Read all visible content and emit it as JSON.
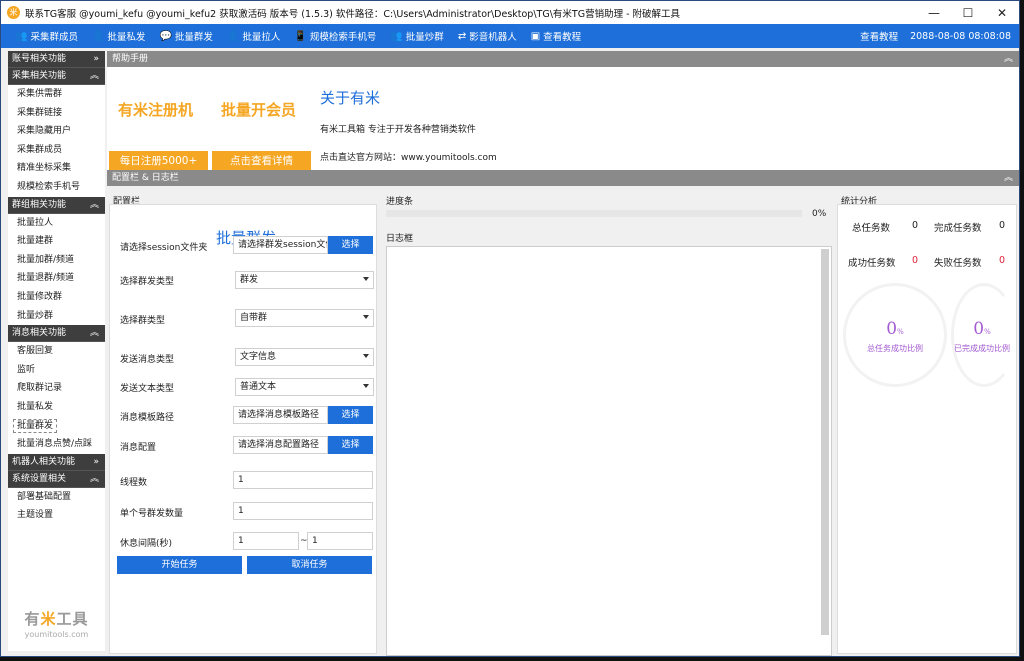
{
  "window": {
    "app_icon": "米",
    "title": "联系TG客服 @youmi_kefu @youmi_kefu2 获取激活码 版本号 (1.5.3) 软件路径：C:\\Users\\Administrator\\Desktop\\TG\\有米TG营销助理 - 附破解工具",
    "min_icon": "—",
    "max_icon": "☐",
    "close_icon": "✕"
  },
  "menubar": {
    "items": [
      {
        "icon": "👥",
        "label": "采集群成员"
      },
      {
        "icon": "👤",
        "label": "批量私发"
      },
      {
        "icon": "💬",
        "label": "批量群发"
      },
      {
        "icon": "👤",
        "label": "批量拉人"
      },
      {
        "icon": "📱",
        "label": "规模检索手机号"
      },
      {
        "icon": "👥",
        "label": "批量炒群"
      },
      {
        "icon": "⇄",
        "label": "影音机器人"
      },
      {
        "icon": "▣",
        "label": "查看教程"
      }
    ],
    "right_link": "查看教程",
    "datetime": "2088-08-08 08:08:08"
  },
  "sidebar": {
    "sections": [
      {
        "title": "账号相关功能",
        "chevron": "»",
        "items": []
      },
      {
        "title": "采集相关功能",
        "chevron": "︽",
        "items": [
          "采集供需群",
          "采集群链接",
          "采集隐藏用户",
          "采集群成员",
          "精准坐标采集",
          "规模检索手机号"
        ]
      },
      {
        "title": "群组相关功能",
        "chevron": "︽",
        "items": [
          "批量拉人",
          "批量建群",
          "批量加群/频道",
          "批量退群/频道",
          "批量修改群",
          "批量炒群"
        ]
      },
      {
        "title": "消息相关功能",
        "chevron": "︽",
        "items": [
          "客服回复",
          "监听",
          "爬取群记录",
          "批量私发",
          "批量群发",
          "批量消息点赞/点踩"
        ]
      },
      {
        "title": "机器人相关功能",
        "chevron": "»",
        "items": []
      },
      {
        "title": "系统设置相关",
        "chevron": "︽",
        "items": [
          "部署基础配置",
          "主题设置"
        ]
      }
    ],
    "active_item": "批量群发",
    "logo_a": "有",
    "logo_b": "米",
    "logo_c": "工具",
    "logo_url": "youmitools.com"
  },
  "help": {
    "header": "帮助手册",
    "chevron": "︽",
    "promo_left": "有米注册机",
    "promo_right": "批量开会员",
    "btn_left": "每日注册5000+",
    "btn_right": "点击查看详情",
    "about_title": "关于有米",
    "about_desc": "有米工具箱 专注于开发各种营销类软件",
    "about_site": "点击直达官方网站：www.youmitools.com"
  },
  "config_bar": {
    "header": "配置栏 & 日志栏",
    "chevron": "︽"
  },
  "config": {
    "group_title": "配置栏",
    "title": "批量群发",
    "session_label": "请选择session文件夹",
    "session_value": "请选择群发session文件夹",
    "select_label": "选择",
    "send_type_label": "选择群发类型",
    "send_type_value": "群发",
    "group_type_label": "选择群类型",
    "group_type_value": "自带群",
    "msg_type_label": "发送消息类型",
    "msg_type_value": "文字信息",
    "text_type_label": "发送文本类型",
    "text_type_value": "普通文本",
    "template_label": "消息模板路径",
    "template_value": "请选择消息模板路径",
    "msg_cfg_label": "消息配置",
    "msg_cfg_value": "请选择消息配置路径",
    "threads_label": "线程数",
    "threads_value": "1",
    "per_account_label": "单个号群发数量",
    "per_account_value": "1",
    "interval_label": "休息间隔(秒)",
    "interval_min": "1",
    "interval_sep": "~",
    "interval_max": "1",
    "start_btn": "开始任务",
    "cancel_btn": "取消任务"
  },
  "progress": {
    "group_title": "进度条",
    "value": 0,
    "label": "0%"
  },
  "log": {
    "group_title": "日志框"
  },
  "stats": {
    "group_title": "统计分析",
    "total_label": "总任务数",
    "total_value": "0",
    "done_label": "完成任务数",
    "done_value": "0",
    "success_label": "成功任务数",
    "success_value": "0",
    "fail_label": "失败任务数",
    "fail_value": "0",
    "ring1_value": "0",
    "ring1_unit": "%",
    "ring1_caption": "总任务成功比例",
    "ring2_value": "0",
    "ring2_unit": "%",
    "ring2_caption": "已完成成功比例",
    "accent_color": "#a35bd1",
    "fail_color": "#e0203a"
  }
}
